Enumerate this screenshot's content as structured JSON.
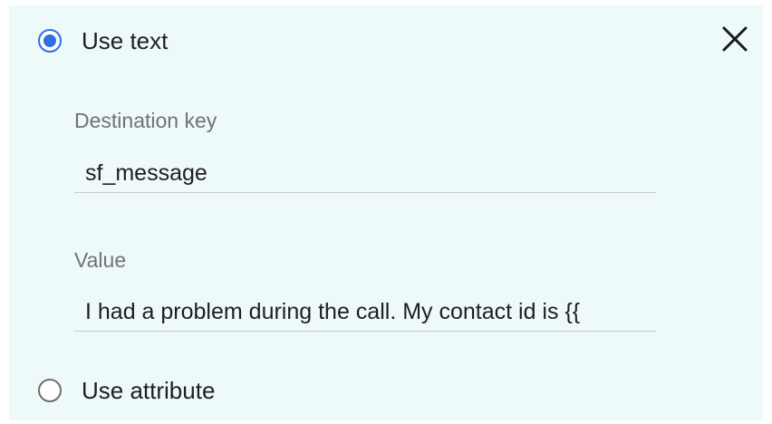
{
  "options": {
    "use_text": {
      "label": "Use text",
      "selected": true
    },
    "use_attribute": {
      "label": "Use attribute",
      "selected": false
    }
  },
  "destination_key": {
    "label": "Destination key",
    "value": "sf_message"
  },
  "value_field": {
    "label": "Value",
    "value": "I had a problem during the call. My contact id is {{"
  },
  "icons": {
    "close": "close-icon",
    "radio_selected": "radio-selected-icon",
    "radio_unselected": "radio-unselected-icon"
  },
  "colors": {
    "panel_background": "#eef9f9",
    "accent": "#2f6fe0",
    "label_text": "#6f7473",
    "text": "#1f1f1f"
  }
}
